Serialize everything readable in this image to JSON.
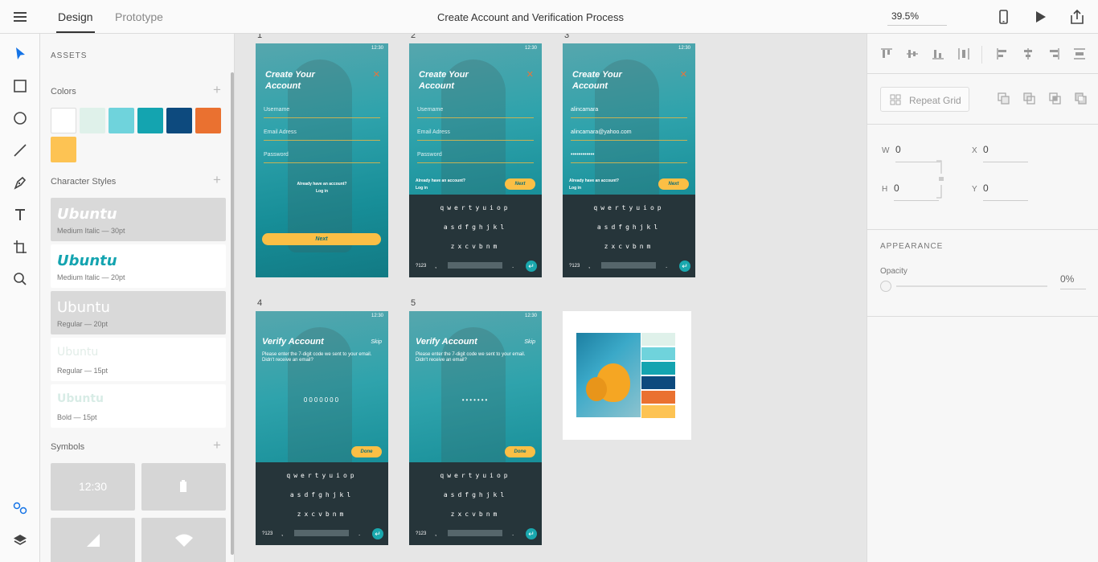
{
  "topbar": {
    "tabs": [
      {
        "label": "Design"
      },
      {
        "label": "Prototype"
      }
    ],
    "title": "Create Account and Verification Process",
    "zoom": "39.5%"
  },
  "assets": {
    "title": "ASSETS",
    "colors_label": "Colors",
    "colors": [
      "#ffffff",
      "#dff1ea",
      "#6fd3dc",
      "#14a4b0",
      "#0d4a7e",
      "#ea7130",
      "#fdc353"
    ],
    "char_styles_label": "Character Styles",
    "char_styles": [
      {
        "name": "Ubuntu",
        "desc": "Medium Italic — 30pt"
      },
      {
        "name": "Ubuntu",
        "desc": "Medium Italic — 20pt"
      },
      {
        "name": "Ubuntu",
        "desc": "Regular — 20pt"
      },
      {
        "name": "Ubuntu",
        "desc": "Regular — 15pt"
      },
      {
        "name": "Ubuntu",
        "desc": "Bold — 15pt"
      }
    ],
    "symbols_label": "Symbols",
    "symbols": [
      {
        "label": "12:30"
      }
    ]
  },
  "canvas": {
    "artboards": [
      {
        "num": "1",
        "title": "Create Your\nAccount",
        "fields": [
          "Username",
          "Email Adress",
          "Password"
        ],
        "hint": "Already have an account?",
        "login": "Log in",
        "button": "Next",
        "status": "12:30"
      },
      {
        "num": "2",
        "title": "Create Your\nAccount",
        "fields": [
          "Username",
          "Email Adress",
          "Password"
        ],
        "hint": "Already have an account?",
        "login": "Log in",
        "button": "Next",
        "status": "12:30"
      },
      {
        "num": "3",
        "title": "Create Your\nAccount",
        "fields": [
          "alincamara",
          "alincamara@yahoo.com",
          "••••••••••••"
        ],
        "hint": "Already have an account?",
        "login": "Log in",
        "button": "Next",
        "status": "12:30"
      },
      {
        "num": "4",
        "title": "Verify Account",
        "skip": "Skip",
        "desc": "Please enter the 7-digit code we sent to your email. Didn't receive an email?",
        "code": "0000000",
        "button": "Done",
        "status": "12:30"
      },
      {
        "num": "5",
        "title": "Verify Account",
        "skip": "Skip",
        "desc": "Please enter the 7-digit code we sent to your email. Didn't receive an email?",
        "code": "•••••••",
        "button": "Done",
        "status": "12:30"
      }
    ],
    "keyboard": {
      "row1": "qwertyuiop",
      "row2": "asdfghjkl",
      "row3": "zxcvbnm",
      "numkey": "?123",
      "comma": ",",
      "period": "."
    }
  },
  "properties": {
    "repeat_grid": "Repeat Grid",
    "w_label": "W",
    "w_value": "0",
    "h_label": "H",
    "h_value": "0",
    "x_label": "X",
    "x_value": "0",
    "y_label": "Y",
    "y_value": "0",
    "appearance_label": "APPEARANCE",
    "opacity_label": "Opacity",
    "opacity_value": "0%"
  }
}
